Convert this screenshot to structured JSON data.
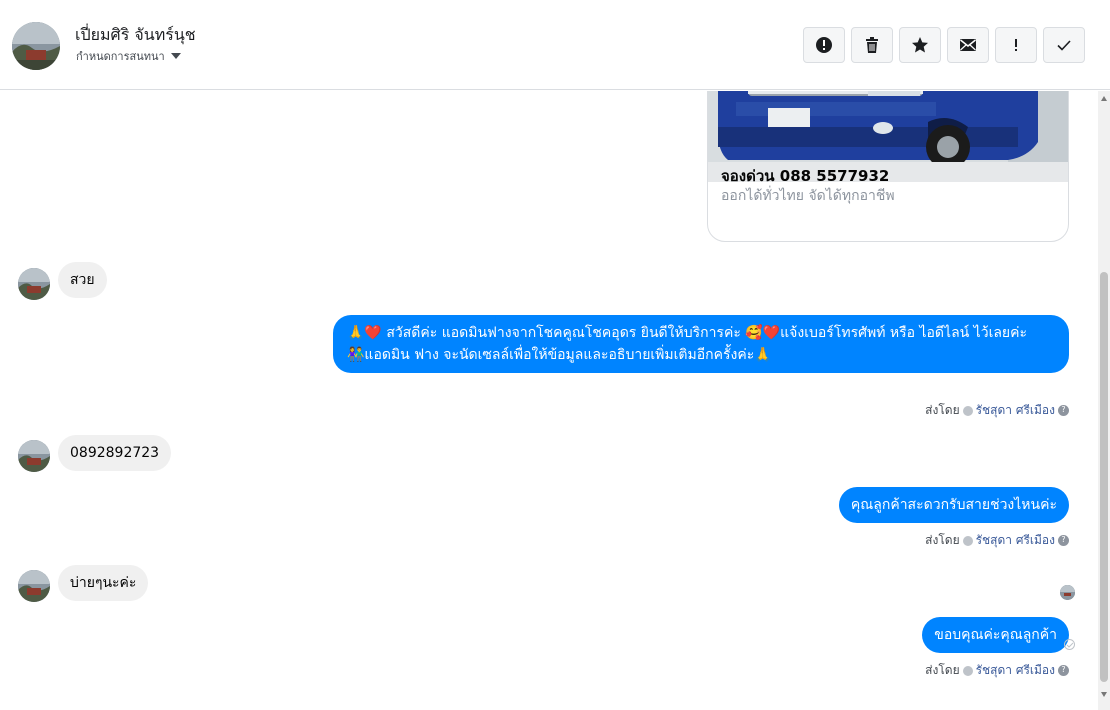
{
  "header": {
    "contact_name": "เปี่ยมศิริ จันทร์นุช",
    "conversation_settings": "กำหนดการสนทนา"
  },
  "toolbar": {
    "buttons": [
      {
        "icon": "alert-circle-icon"
      },
      {
        "icon": "trash-icon"
      },
      {
        "icon": "star-icon"
      },
      {
        "icon": "envelope-icon"
      },
      {
        "icon": "exclamation-icon"
      },
      {
        "icon": "check-icon"
      }
    ]
  },
  "card": {
    "title": "จองด่วน 088 5577932",
    "subtitle": "ออกได้ทั่วไทย จัดได้ทุกอาชีพ"
  },
  "messages": [
    {
      "direction": "in",
      "text": "สวย"
    },
    {
      "direction": "out",
      "line1": "🙏❤️ สวัสดีค่ะ แอดมินฟางจากโชคคูณโชคอุดร ยินดีให้บริการค่ะ 🥰❤️แจ้งเบอร์โทรศัพท์ หรือ ไอดีไลน์ ไว้เลยค่ะ",
      "line2": "👫แอดมิน ฟาง จะนัดเซลล์เพื่อให้ข้อมูลและอธิบายเพิ่มเติมอีกครั้งค่ะ🙏"
    },
    {
      "direction": "in",
      "text": "0892892723"
    },
    {
      "direction": "out",
      "text": "คุณลูกค้าสะดวกรับสายช่วงไหนค่ะ"
    },
    {
      "direction": "in",
      "text": "บ่ายๆนะค่ะ"
    },
    {
      "direction": "out",
      "text": "ขอบคุณค่ะคุณลูกค้า"
    }
  ],
  "sent_by": {
    "prefix": "ส่งโดย",
    "name": "รัชสุดา ศรีเมือง"
  },
  "colors": {
    "outgoing_bubble": "#0084ff",
    "incoming_bubble": "#f0f0f0",
    "sender_name": "#385898"
  }
}
